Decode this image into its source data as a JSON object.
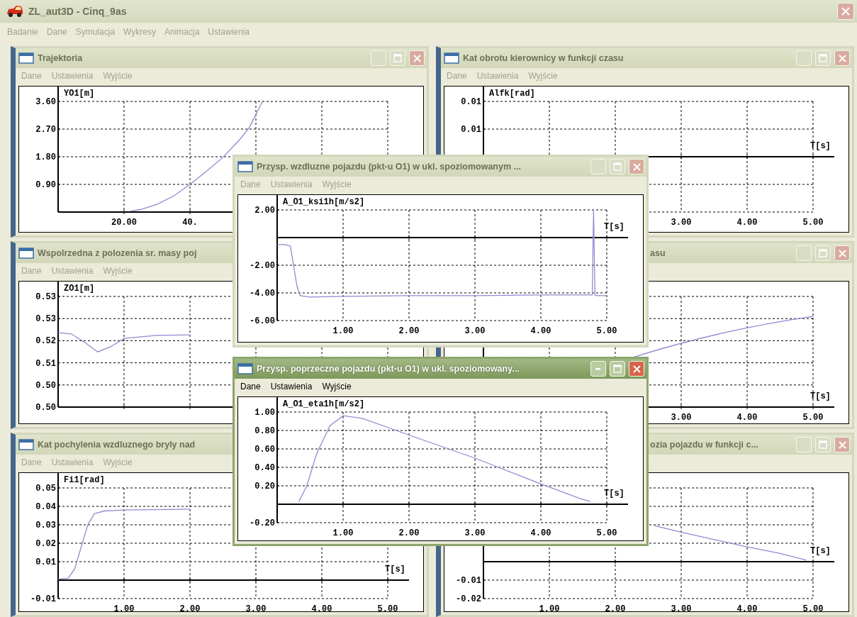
{
  "app": {
    "title": "ZL_aut3D - Cinq_9as",
    "menu": [
      "Badanie",
      "Dane",
      "Symulacja",
      "Wykresy",
      "Animacja",
      "Ustawienia"
    ]
  },
  "windows": [
    {
      "title": "Trajektoria",
      "active": false,
      "menu": [
        "Dane",
        "Ustawienia",
        "Wyjście"
      ],
      "chart_data": {
        "type": "line",
        "grid": true,
        "ylabel": "YO1[m]",
        "xlim": [
          0,
          100
        ],
        "ylim": [
          0,
          3.6
        ],
        "xticks": [
          {
            "value": 20,
            "label": "20.00"
          },
          {
            "value": 40,
            "label": "40."
          }
        ],
        "yticks": [
          {
            "value": 3.6,
            "label": "3.60"
          },
          {
            "value": 2.7,
            "label": "2.70"
          },
          {
            "value": 1.8,
            "label": "1.80"
          },
          {
            "value": 0.9,
            "label": "0.90"
          }
        ],
        "x": [
          22,
          25,
          30,
          35,
          40,
          45,
          50,
          55,
          58,
          62
        ],
        "series": [
          {
            "color": "#8c8cd0",
            "values": [
              0.03,
              0.08,
              0.25,
              0.52,
              0.9,
              1.33,
              1.78,
              2.35,
              2.75,
              3.6
            ]
          }
        ]
      }
    },
    {
      "title": "Kat obrotu kierownicy w funkcji czasu",
      "active": false,
      "menu": [
        "Dane",
        "Ustawienia",
        "Wyjście"
      ],
      "chart_data": {
        "type": "line",
        "grid": true,
        "ylabel": "Alfk[rad]",
        "xlabel": "T[s]",
        "xlim": [
          0,
          5
        ],
        "ylim": [
          -0.01,
          0.01
        ],
        "xticks": [
          {
            "value": 3,
            "label": "3.00"
          },
          {
            "value": 4,
            "label": "4.00"
          },
          {
            "value": 5,
            "label": "5.00"
          }
        ],
        "yticks": [
          {
            "value": 0.01,
            "label": "0.01"
          },
          {
            "value": 0.005,
            "label": "0.01"
          }
        ]
      }
    },
    {
      "title": "Wspolrzedna z polozenia sr. masy poj",
      "active": false,
      "menu": [
        "Dane",
        "Ustawienia",
        "Wyjście"
      ],
      "chart_data": {
        "type": "line",
        "grid": true,
        "ylabel": "ZO1[m]",
        "xlim": [
          0,
          5
        ],
        "ylim": [
          0.496,
          0.5335
        ],
        "yticks": [
          {
            "value": 0.5335,
            "label": "0.53"
          },
          {
            "value": 0.526,
            "label": "0.53"
          },
          {
            "value": 0.5185,
            "label": "0.52"
          },
          {
            "value": 0.511,
            "label": "0.51"
          },
          {
            "value": 0.5035,
            "label": "0.50"
          },
          {
            "value": 0.496,
            "label": "0.50"
          }
        ],
        "x": [
          0,
          0.2,
          0.4,
          0.6,
          0.8,
          1,
          1.5,
          2
        ],
        "series": [
          {
            "color": "#8c8cd0",
            "values": [
              0.5212,
              0.5208,
              0.518,
              0.5147,
              0.5165,
              0.5193,
              0.5203,
              0.5205
            ]
          }
        ]
      }
    },
    {
      "title": "asu",
      "active": false,
      "chart": {
        "xlabel": "T[s]",
        "xtick_labels": [
          "3.00",
          "4.00",
          "5.00"
        ]
      }
    },
    {
      "title": "Kat pochylenia wzdluznego bryly nad",
      "active": false,
      "menu": [
        "Dane",
        "Ustawienia",
        "Wyjście"
      ],
      "chart_data": {
        "type": "line",
        "grid": true,
        "ylabel": "Fi1[rad]",
        "xlabel": "T[s]",
        "xlim": [
          0,
          5
        ],
        "ylim": [
          -0.01,
          0.05
        ],
        "xticks": [
          {
            "value": 1,
            "label": "1.00"
          },
          {
            "value": 2,
            "label": "2.00"
          },
          {
            "value": 3,
            "label": "3.00"
          },
          {
            "value": 4,
            "label": "4.00"
          },
          {
            "value": 5,
            "label": "5.00"
          }
        ],
        "yticks": [
          {
            "value": 0.05,
            "label": "0.05"
          },
          {
            "value": 0.04,
            "label": "0.04"
          },
          {
            "value": 0.03,
            "label": "0.03"
          },
          {
            "value": 0.02,
            "label": "0.02"
          },
          {
            "value": 0.01,
            "label": "0.01"
          },
          {
            "value": -0.01,
            "label": "-0.01"
          }
        ],
        "x": [
          0,
          0.15,
          0.25,
          0.35,
          0.45,
          0.55,
          0.7,
          1,
          2
        ],
        "series": [
          {
            "color": "#8c8cd0",
            "values": [
              0.0005,
              0.001,
              0.006,
              0.018,
              0.03,
              0.036,
              0.0375,
              0.038,
              0.0385
            ]
          }
        ]
      }
    },
    {
      "title": "ozia pojazdu w funkcji c...",
      "active": false,
      "chart_data": {
        "type": "line",
        "grid": true,
        "xlabel": "T[s]",
        "xlim": [
          0,
          5
        ],
        "ylim": [
          -0.02,
          0.04
        ],
        "xticks": [
          {
            "value": 1,
            "label": "1.00"
          },
          {
            "value": 2,
            "label": "2.00"
          },
          {
            "value": 3,
            "label": "3.00"
          },
          {
            "value": 4,
            "label": "4.00"
          },
          {
            "value": 5,
            "label": "5.00"
          }
        ],
        "yticks": [
          {
            "value": -0.01,
            "label": "-0.01"
          },
          {
            "value": -0.02,
            "label": "-0.02"
          }
        ],
        "x": [
          2.6,
          3,
          3.5,
          4,
          4.5,
          4.9
        ],
        "series": [
          {
            "color": "#8c8cd0",
            "values": [
              0.0195,
              0.016,
              0.012,
              0.008,
              0.0045,
              0.0008
            ]
          }
        ]
      }
    },
    {
      "title": "Przysp. wzdluzne pojazdu (pkt-u O1) w ukl. spoziomowanym ...",
      "active": false,
      "menu": [
        "Dane",
        "Ustawienia",
        "Wyjście"
      ],
      "chart_data": {
        "type": "line",
        "grid": true,
        "ylabel": "A_O1_ksi1h[m/s2]",
        "xlabel": "T[s]",
        "xlim": [
          0,
          5
        ],
        "ylim": [
          -6,
          2
        ],
        "xticks": [
          {
            "value": 1,
            "label": "1.00"
          },
          {
            "value": 2,
            "label": "2.00"
          },
          {
            "value": 3,
            "label": "3.00"
          },
          {
            "value": 4,
            "label": "4.00"
          },
          {
            "value": 5,
            "label": "5.00"
          }
        ],
        "yticks": [
          {
            "value": 2,
            "label": "2.00"
          },
          {
            "value": -2,
            "label": "-2.00"
          },
          {
            "value": -4,
            "label": "-4.00"
          },
          {
            "value": -6,
            "label": "-6.00"
          }
        ],
        "x": [
          0,
          0.1,
          0.2,
          0.3,
          0.35,
          0.5,
          1,
          2,
          3,
          4,
          4.78,
          4.8,
          4.82,
          4.84,
          4.9,
          5
        ],
        "series": [
          {
            "color": "#8c8cd0",
            "values": [
              -0.5,
              -0.5,
              -0.6,
              -3.5,
              -4.2,
              -4.3,
              -4.25,
              -4.2,
              -4.2,
              -4.15,
              -4.15,
              2,
              -4.15,
              -4.2,
              -4.2,
              -4.2
            ]
          }
        ]
      }
    },
    {
      "title": "Przysp. poprzeczne pojazdu (pkt-u O1) w ukl. spoziomowany...",
      "active": true,
      "menu": [
        "Dane",
        "Ustawienia",
        "Wyjście"
      ],
      "chart_data": {
        "type": "line",
        "grid": true,
        "ylabel": "A_O1_eta1h[m/s2]",
        "xlabel": "T[s]",
        "xlim": [
          0,
          5
        ],
        "ylim": [
          -0.2,
          1
        ],
        "xticks": [
          {
            "value": 1,
            "label": "1.00"
          },
          {
            "value": 2,
            "label": "2.00"
          },
          {
            "value": 3,
            "label": "3.00"
          },
          {
            "value": 4,
            "label": "4.00"
          },
          {
            "value": 5,
            "label": "5.00"
          }
        ],
        "yticks": [
          {
            "value": 1,
            "label": "1.00"
          },
          {
            "value": 0.8,
            "label": "0.80"
          },
          {
            "value": 0.6,
            "label": "0.60"
          },
          {
            "value": 0.4,
            "label": "0.40"
          },
          {
            "value": 0.2,
            "label": "0.20"
          },
          {
            "value": -0.2,
            "label": "-0.20"
          }
        ],
        "x": [
          0.33,
          0.45,
          0.6,
          0.8,
          1,
          1.3,
          2,
          3,
          4,
          4.6,
          4.75
        ],
        "series": [
          {
            "color": "#8c8cd0",
            "values": [
              0.03,
              0.2,
              0.55,
              0.85,
              0.96,
              0.93,
              0.75,
              0.5,
              0.22,
              0.06,
              0.03
            ]
          }
        ]
      }
    }
  ]
}
